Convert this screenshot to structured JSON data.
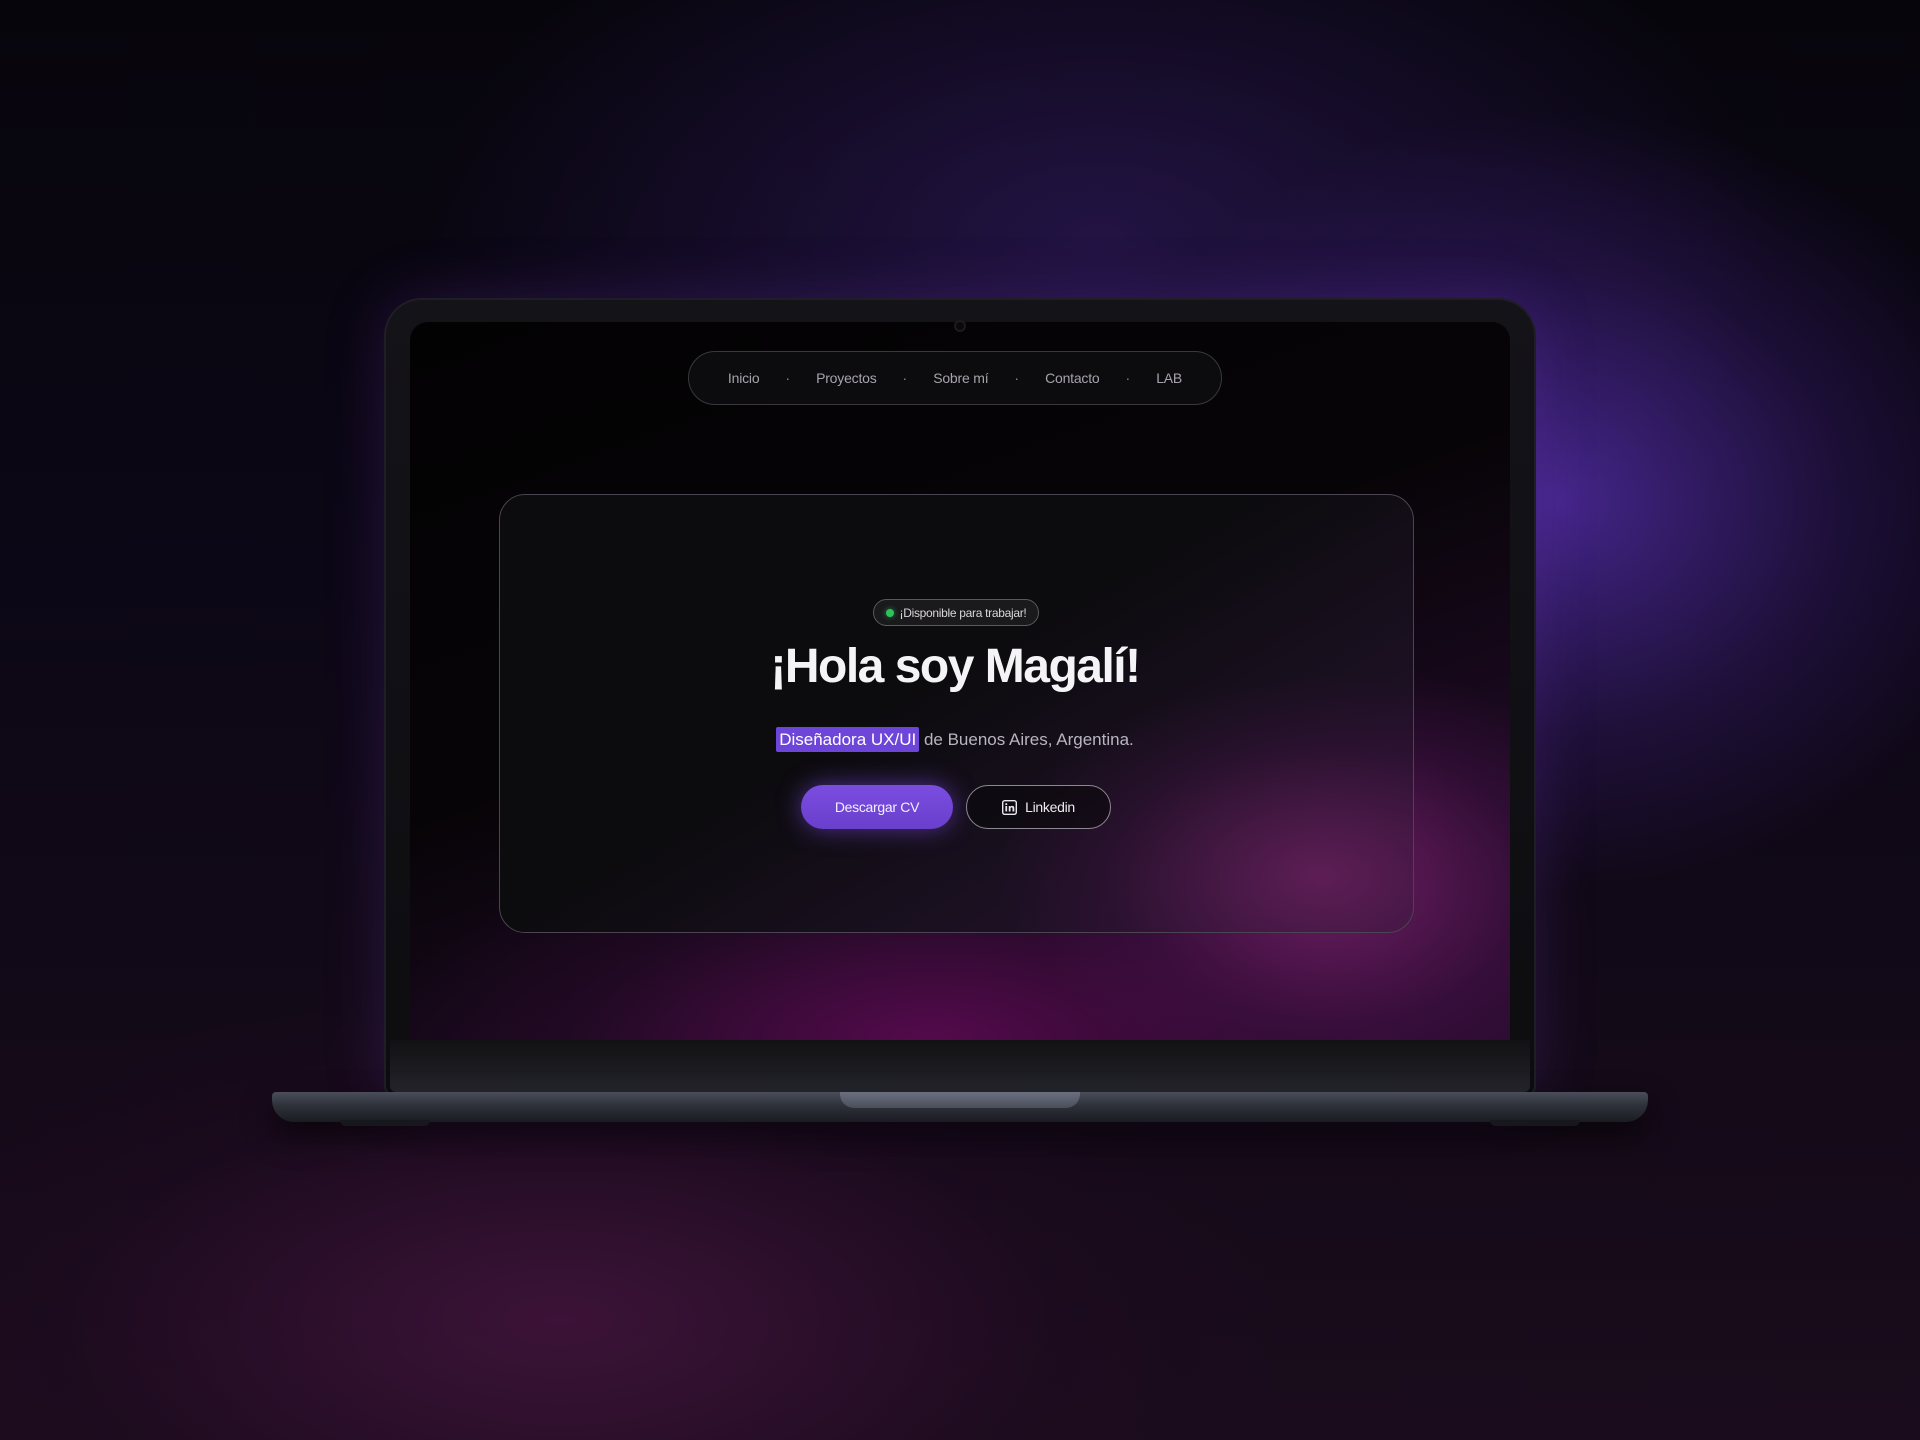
{
  "nav": {
    "items": [
      {
        "label": "Inicio"
      },
      {
        "label": "Proyectos"
      },
      {
        "label": "Sobre mí"
      },
      {
        "label": "Contacto"
      },
      {
        "label": "LAB"
      }
    ],
    "separator": "·"
  },
  "hero": {
    "badge": {
      "text": "¡Disponible para trabajar!",
      "status_color": "#2ec25a"
    },
    "title": "¡Hola soy Magalí!",
    "subtitle": {
      "highlight": "Diseñadora UX/UI",
      "rest": " de Buenos Aires, Argentina."
    },
    "buttons": {
      "primary": "Descargar CV",
      "secondary": "Linkedin",
      "secondary_icon": "linkedin-icon"
    }
  },
  "colors": {
    "accent": "#6d45d8",
    "primary_button": "#7a4de0"
  }
}
